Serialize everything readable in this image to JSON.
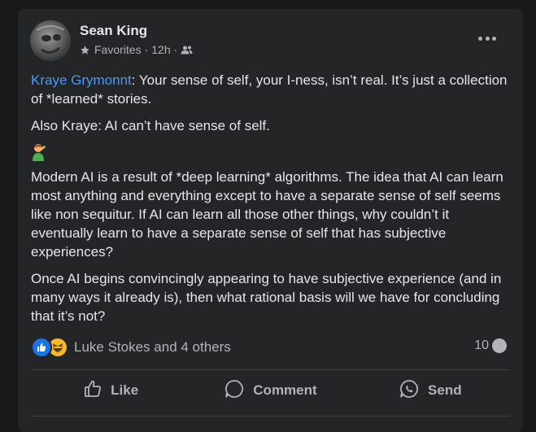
{
  "post": {
    "author": "Sean King",
    "audience_label": "Favorites",
    "separator": "·",
    "time": "12h",
    "mention": "Kraye Grymonnt",
    "paragraph1_rest": ":  Your sense of self, your I-ness, isn’t real.  It’s just a collection of *learned* stories.",
    "paragraph2": "Also Kraye:  AI can’t have sense of self.",
    "emoji": "🤦‍♂️",
    "paragraph3": "Modern AI is a result of *deep learning* algorithms.   The idea that AI can learn most anything and everything except to have a separate sense of self seems like non sequitur.   If AI can learn all those other things, why couldn’t it eventually learn to have a separate sense of self that has subjective experiences?",
    "paragraph4": "Once AI begins convincingly appearing to have subjective experience (and in many ways it already is), then what rational basis will we have for concluding that it’s not?"
  },
  "reactions": {
    "summary": "Luke Stokes and 4 others",
    "comment_count": "10"
  },
  "actions": {
    "like": "Like",
    "comment": "Comment",
    "send": "Send"
  },
  "icons": {
    "audience": "star-icon",
    "privacy": "friends-icon",
    "more": "more-icon"
  },
  "colors": {
    "card": "#242526",
    "mention": "#4599ff",
    "like_reaction": "#1b74e4",
    "haha_reaction": "#f7b928"
  }
}
